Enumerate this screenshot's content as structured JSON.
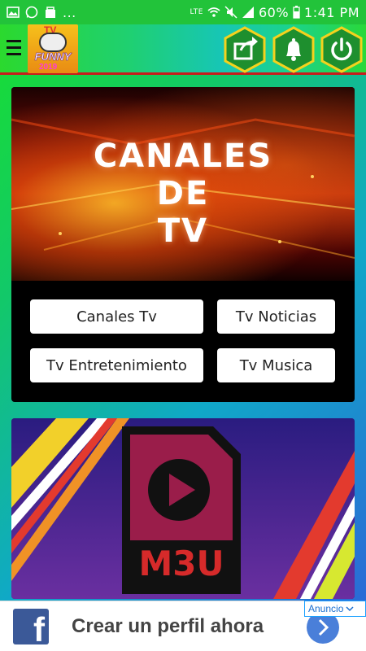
{
  "status_bar": {
    "battery": "60%",
    "time": "1:41 PM",
    "network": "LTE",
    "dots": "...",
    "icons": [
      "image-icon",
      "whatsapp-icon",
      "store-icon",
      "wifi-icon",
      "mute-icon",
      "signal-icon",
      "battery-icon"
    ]
  },
  "app_bar": {
    "logo": {
      "top": "TV",
      "middle": "FUNNY",
      "bottom": "2019"
    },
    "actions": [
      "share-icon",
      "bell-icon",
      "power-icon"
    ],
    "accent_color": "#1e8f2e",
    "action_stroke_color": "#f4d21d"
  },
  "card_tv": {
    "banner_title_lines": [
      "CANALES",
      "DE",
      "TV"
    ],
    "buttons": [
      "Canales Tv",
      "Tv Noticias",
      "Tv Entretenimiento",
      "Tv Musica"
    ]
  },
  "card_m3u": {
    "file_label": "M3U"
  },
  "ad": {
    "badge_label": "Anuncio",
    "text": "Crear un perfil ahora",
    "brand_letter": "f",
    "brand_color": "#3b5998"
  }
}
